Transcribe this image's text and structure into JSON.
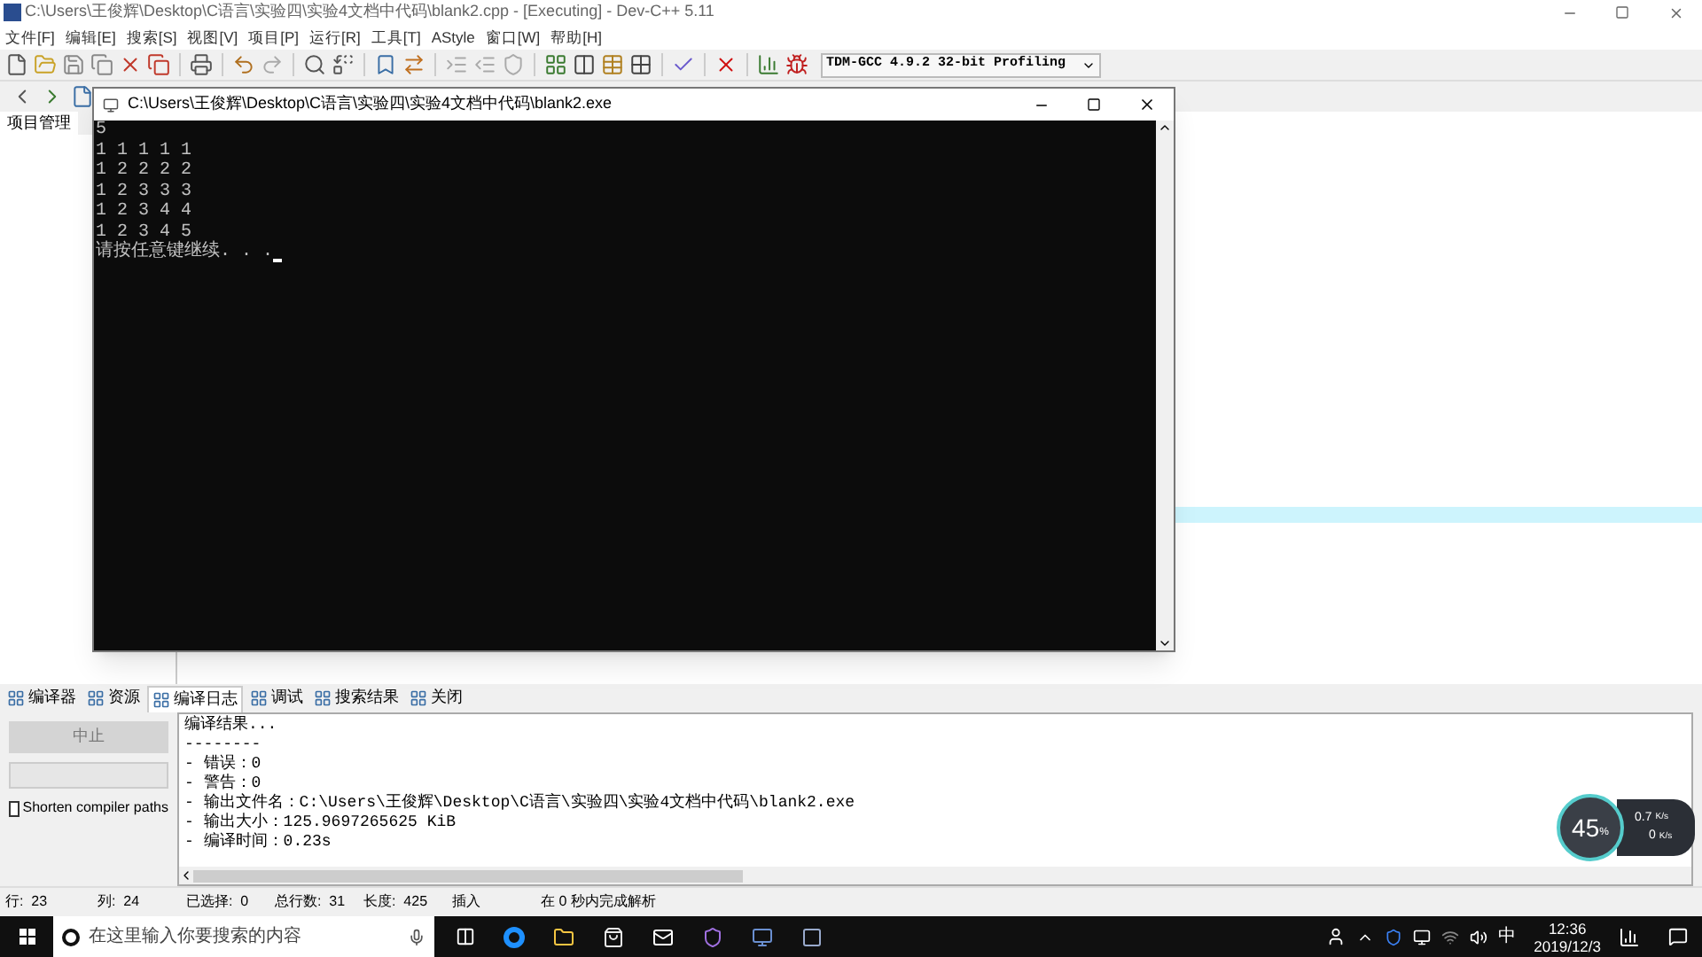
{
  "window": {
    "title": "C:\\Users\\王俊辉\\Desktop\\C语言\\实验四\\实验4文档中代码\\blank2.cpp - [Executing] - Dev-C++ 5.11"
  },
  "menu": [
    "文件[F]",
    "编辑[E]",
    "搜索[S]",
    "视图[V]",
    "项目[P]",
    "运行[R]",
    "工具[T]",
    "AStyle",
    "窗口[W]",
    "帮助[H]"
  ],
  "toolbar": {
    "compiler": "TDM-GCC 4.9.2 32-bit Profiling"
  },
  "left_panel": {
    "tabs": [
      {
        "label": "项目管理",
        "selected": true
      }
    ]
  },
  "console": {
    "title": "C:\\Users\\王俊辉\\Desktop\\C语言\\实验四\\实验4文档中代码\\blank2.exe",
    "lines": [
      "5",
      "1 1 1 1 1",
      "1 2 2 2 2",
      "1 2 3 3 3",
      "1 2 3 4 4",
      "1 2 3 4 5",
      "请按任意键继续. . ."
    ]
  },
  "bottom_tabs": [
    {
      "label": "编译器",
      "selected": false
    },
    {
      "label": "资源",
      "selected": false
    },
    {
      "label": "编译日志",
      "selected": true
    },
    {
      "label": "调试",
      "selected": false
    },
    {
      "label": "搜索结果",
      "selected": false
    },
    {
      "label": "关闭",
      "selected": false
    }
  ],
  "compile_panel": {
    "abort_button": {
      "label": "中止",
      "disabled": true
    },
    "shorten_paths": {
      "label": "Shorten compiler paths",
      "checked": false
    },
    "log": [
      "编译结果...",
      "--------",
      "- 错误：0",
      "- 警告：0",
      "- 输出文件名：C:\\Users\\王俊辉\\Desktop\\C语言\\实验四\\实验4文档中代码\\blank2.exe",
      "- 输出大小：125.9697265625 KiB",
      "- 编译时间：0.23s"
    ]
  },
  "status_bar": [
    {
      "label": "行:",
      "value": "23"
    },
    {
      "label": "列:",
      "value": "24"
    },
    {
      "label": "已选择:",
      "value": "0"
    },
    {
      "label": "总行数:",
      "value": "31"
    },
    {
      "label": "长度:",
      "value": "425"
    },
    {
      "label": "插入"
    },
    {
      "label": "在 0 秒内完成解析"
    }
  ],
  "taskbar": {
    "search_placeholder": "在这里输入你要搜索的内容",
    "ime": "中",
    "time": "12:36",
    "date": "2019/12/3"
  },
  "net_widget": {
    "percent": "45",
    "percent_unit": "%",
    "upload": "0.7",
    "upload_unit": "K/s",
    "download": "0",
    "download_unit": "K/s"
  }
}
